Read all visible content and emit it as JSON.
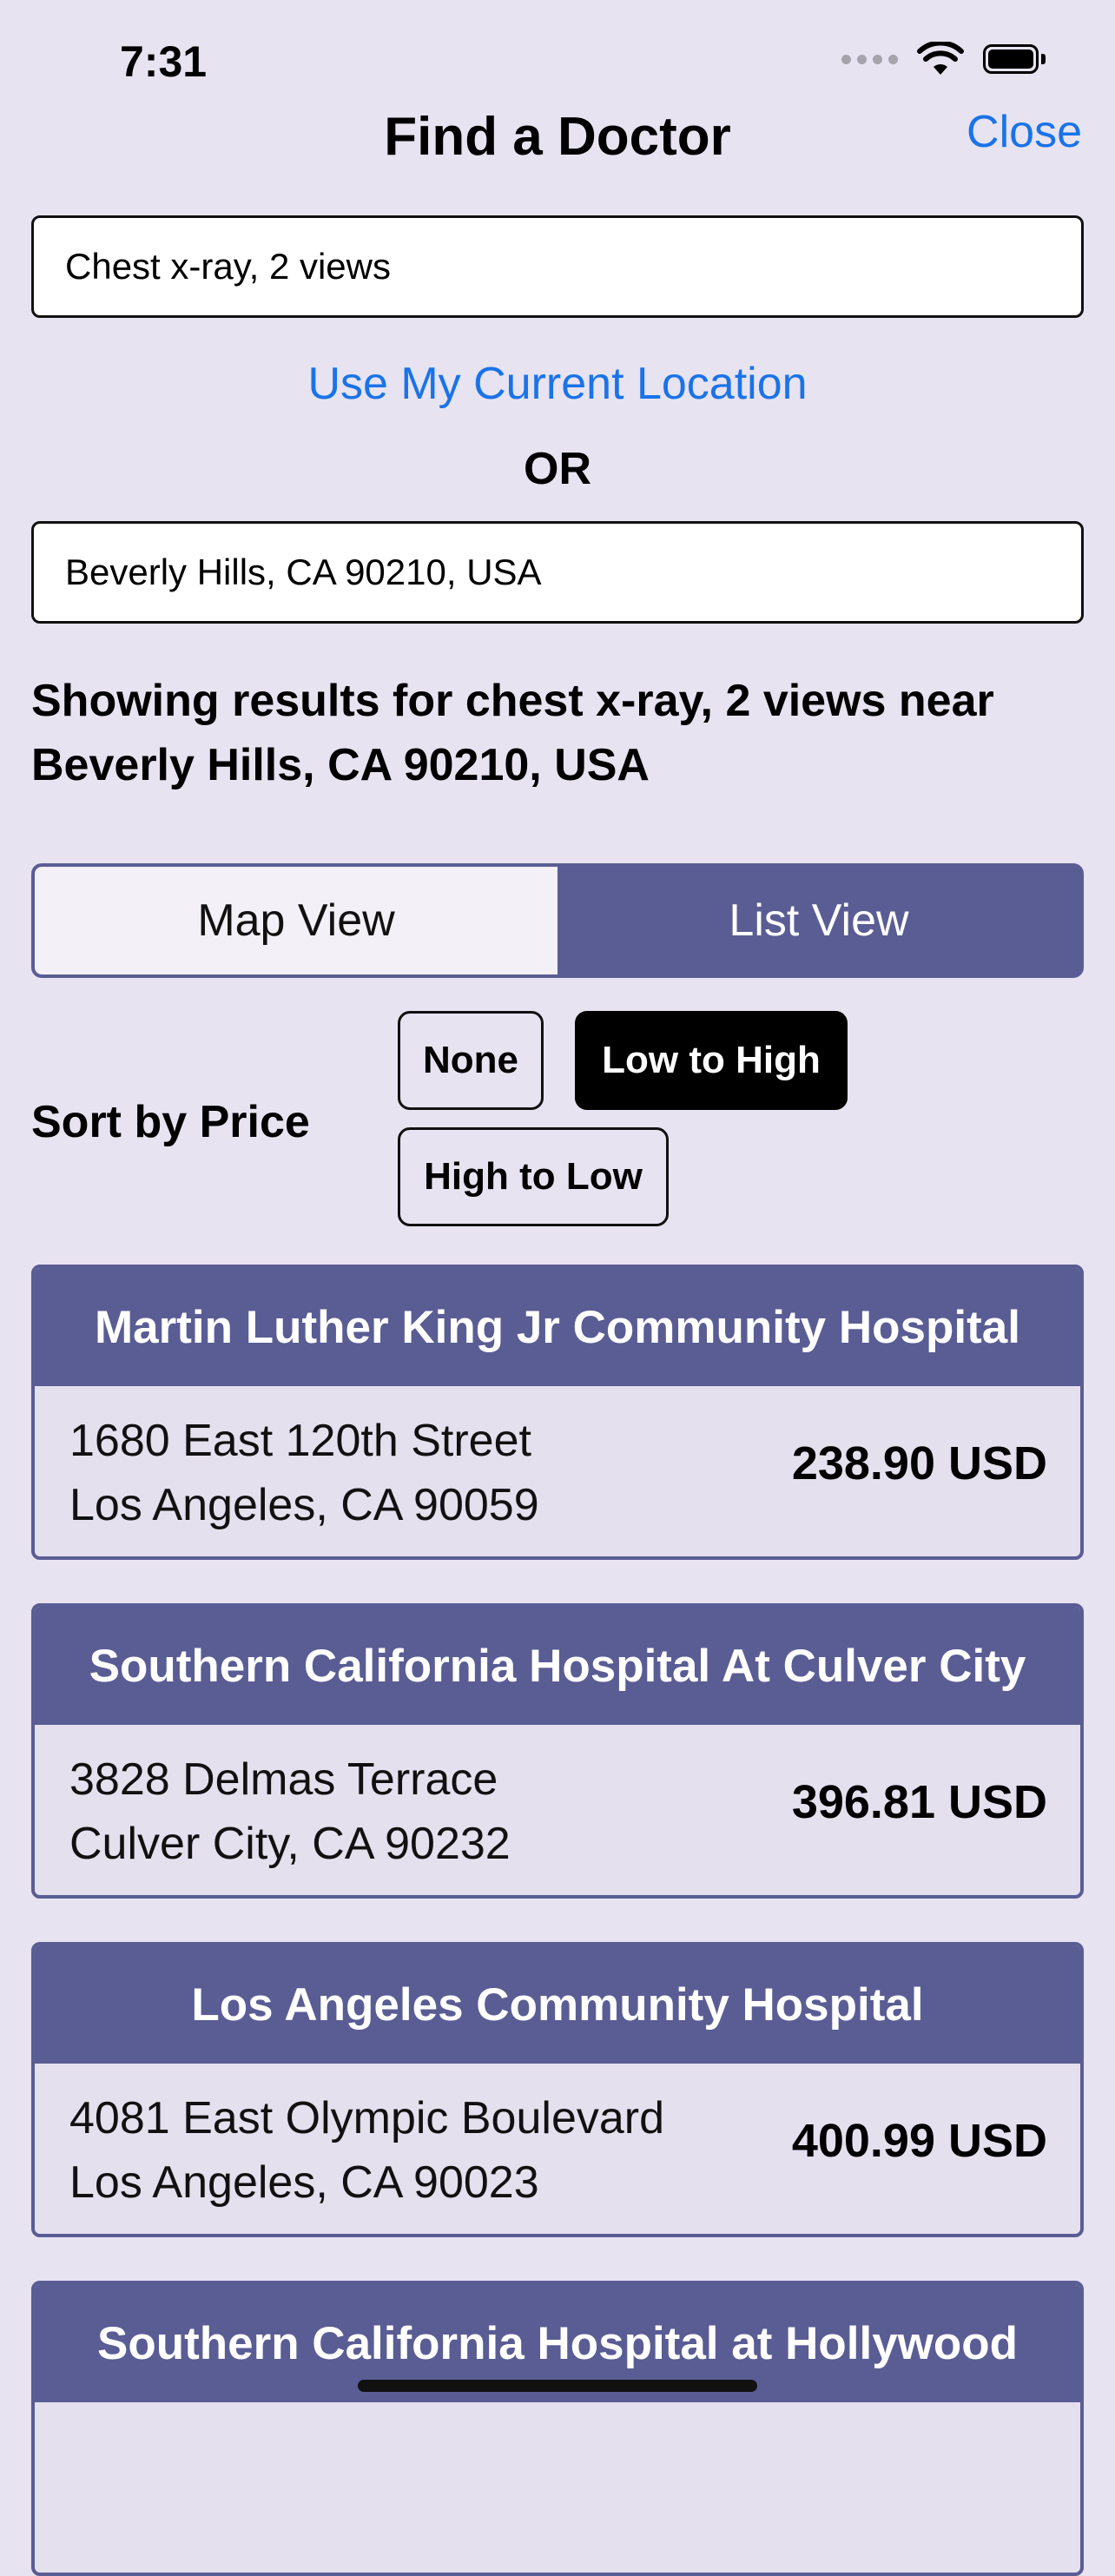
{
  "status_bar": {
    "time": "7:31"
  },
  "nav": {
    "title": "Find a Doctor",
    "close_label": "Close"
  },
  "search": {
    "procedure_value": "Chest x-ray, 2 views",
    "location_value": "Beverly Hills, CA 90210, USA"
  },
  "location": {
    "use_current_label": "Use My Current Location",
    "or_label": "OR"
  },
  "results": {
    "summary": "Showing results for chest x-ray, 2 views near Beverly Hills, CA 90210, USA"
  },
  "view_toggle": {
    "map_label": "Map View",
    "list_label": "List View",
    "selected": "List View"
  },
  "sort": {
    "label": "Sort by Price",
    "options": [
      "None",
      "Low to High",
      "High to Low"
    ],
    "selected": "Low to High"
  },
  "hospitals": [
    {
      "name": "Martin Luther King Jr Community Hospital",
      "street": "1680 East 120th Street",
      "city": "Los Angeles, CA 90059",
      "price": "238.90 USD"
    },
    {
      "name": "Southern California Hospital At Culver City",
      "street": "3828 Delmas Terrace",
      "city": "Culver City, CA 90232",
      "price": "396.81 USD"
    },
    {
      "name": "Los Angeles Community Hospital",
      "street": "4081 East Olympic Boulevard",
      "city": "Los Angeles, CA 90023",
      "price": "400.99 USD"
    },
    {
      "name": "Southern California Hospital at Hollywood"
    }
  ],
  "colors": {
    "background": "#e7e3f0",
    "accent": "#5a5d94",
    "link": "#1a73e8"
  },
  "icons": [
    "cellular-signal-icon",
    "wifi-icon",
    "battery-icon"
  ]
}
